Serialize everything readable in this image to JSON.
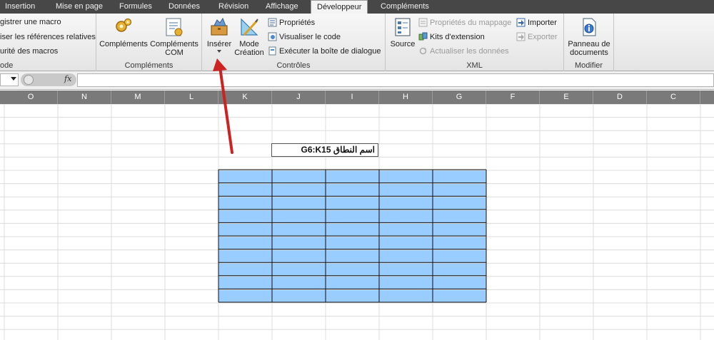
{
  "tabs": {
    "insertion": "Insertion",
    "mise_en_page": "Mise en page",
    "formules": "Formules",
    "donnees": "Données",
    "revision": "Révision",
    "affichage": "Affichage",
    "developpeur": "Développeur",
    "complements": "Compléments"
  },
  "ribbon": {
    "code_group": {
      "label": "ode",
      "record_macro": "gistrer une macro",
      "relative_refs": "iser les références relatives",
      "macro_security": "urité des macros"
    },
    "complements_group": {
      "label": "Compléments",
      "complements_btn": "Compléments",
      "com_btn_line1": "Compléments",
      "com_btn_line2": "COM"
    },
    "controles_group": {
      "label": "Contrôles",
      "inserer": "Insérer",
      "mode_line1": "Mode",
      "mode_line2": "Création",
      "proprietes": "Propriétés",
      "visualiser_code": "Visualiser le code",
      "executer_dialogue": "Exécuter la boîte de dialogue"
    },
    "xml_group": {
      "label": "XML",
      "source": "Source",
      "proprietes_mappage": "Propriétés du mappage",
      "kits_extension": "Kits d'extension",
      "actualiser": "Actualiser les données",
      "importer": "Importer",
      "exporter": "Exporter"
    },
    "modifier_group": {
      "label": "Modifier",
      "panneau_line1": "Panneau de",
      "panneau_line2": "documents"
    }
  },
  "formula_bar": {
    "fx_label": "fx",
    "value": ""
  },
  "columns": [
    "O",
    "N",
    "M",
    "L",
    "K",
    "J",
    "I",
    "H",
    "G",
    "F",
    "E",
    "D",
    "C"
  ],
  "range_label": "اسم النطاق G6:K15",
  "colors": {
    "tabbar": "#474747",
    "highlight_fill": "#99ccff",
    "arrow": "#cc2222"
  }
}
